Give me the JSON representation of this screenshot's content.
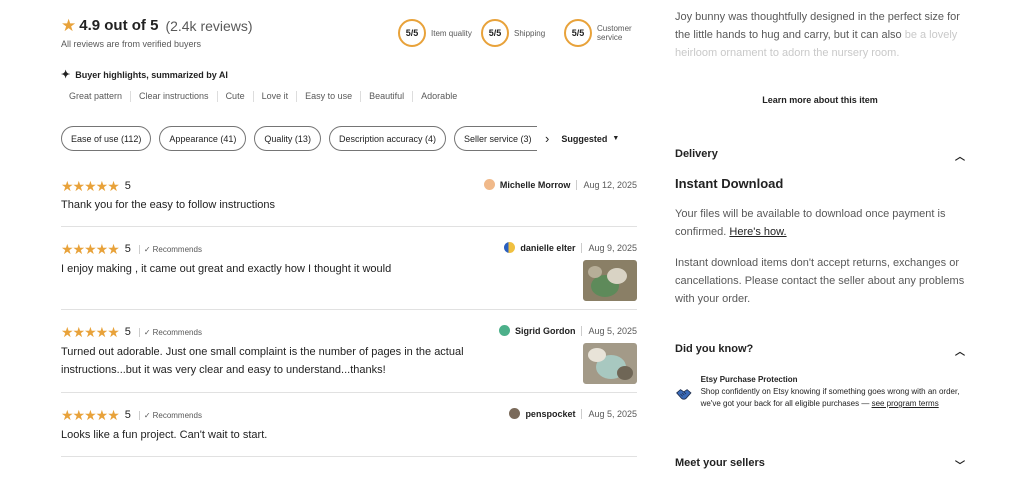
{
  "summary": {
    "score": "4.9 out of 5",
    "count": "(2.4k reviews)",
    "verified": "All reviews are from verified buyers"
  },
  "metrics": [
    {
      "value": "5/5",
      "label": "Item quality"
    },
    {
      "value": "5/5",
      "label": "Shipping"
    },
    {
      "value": "5/5",
      "label": "Customer service"
    }
  ],
  "highlights": {
    "title": "Buyer highlights, summarized by AI",
    "items": [
      "Great pattern",
      "Clear instructions",
      "Cute",
      "Love it",
      "Easy to use",
      "Beautiful",
      "Adorable"
    ]
  },
  "filters": {
    "chips": [
      "Ease of use (112)",
      "Appearance (41)",
      "Quality (13)",
      "Description accuracy (4)",
      "Seller service (3)"
    ],
    "sort": "Suggested"
  },
  "reviews": [
    {
      "rating": "5",
      "recommends": "",
      "name": "Michelle Morrow",
      "date": "Aug 12, 2025",
      "text": "Thank you for the easy to follow instructions",
      "has_photo": false
    },
    {
      "rating": "5",
      "recommends": "Recommends",
      "name": "danielle elter",
      "date": "Aug 9, 2025",
      "text": "I enjoy making , it came out great and exactly how I thought it would",
      "has_photo": true
    },
    {
      "rating": "5",
      "recommends": "Recommends",
      "name": "Sigrid Gordon",
      "date": "Aug 5, 2025",
      "text": "Turned out adorable. Just one small complaint is the number of pages in the actual instructions...but it was very clear and easy to understand...thanks!",
      "has_photo": true
    },
    {
      "rating": "5",
      "recommends": "Recommends",
      "name": "penspocket",
      "date": "Aug 5, 2025",
      "text": "Looks like a fun project. Can't wait to start.",
      "has_photo": false
    }
  ],
  "description": {
    "text": "Joy bunny was thoughtfully designed in the perfect size for the little hands to hug and carry, but it can also",
    "fade_text": "be a lovely heirloom ornament to adorn the nursery room.",
    "learn_more": "Learn more about this item"
  },
  "delivery": {
    "title": "Delivery",
    "heading": "Instant Download",
    "para1": "Your files will be available to download once payment is confirmed.",
    "link": "Here's how.",
    "para2": "Instant download items don't accept returns, exchanges or cancellations. Please contact the seller about any problems with your order."
  },
  "did_you_know": {
    "title": "Did you know?",
    "protect_title": "Etsy Purchase Protection",
    "protect_text": "Shop confidently on Etsy knowing if something goes wrong with an order, we've got your back for all eligible purchases —",
    "protect_link": "see program terms"
  },
  "sellers": {
    "title": "Meet your sellers"
  },
  "colors": {
    "star": "#e8a23a",
    "text": "#222222",
    "muted": "#595959"
  }
}
